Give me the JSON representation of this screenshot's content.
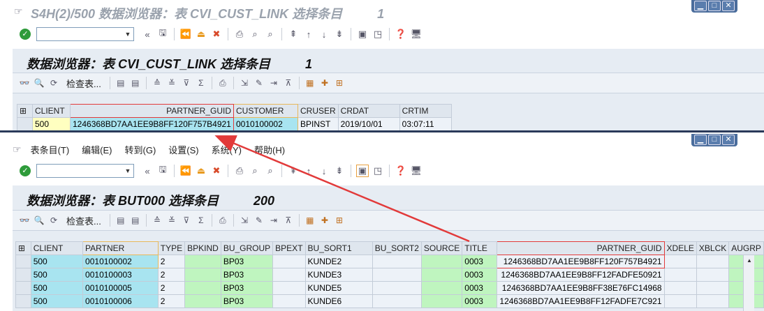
{
  "window1": {
    "title": "S4H(2)/500 数据浏览器：表 CVI_CUST_LINK 选择条目          1"
  },
  "panel1": {
    "title": "数据浏览器：表 CVI_CUST_LINK 选择条目          1",
    "toolbar_text": "检查表..."
  },
  "table1": {
    "headers": [
      "CLIENT",
      "PARTNER_GUID",
      "CUSTOMER",
      "CRUSER",
      "CRDAT",
      "CRTIM"
    ],
    "row": [
      "500",
      "1246368BD7AA1EE9B8FF120F757B4921",
      "0010100002",
      "BPINST",
      "2019/10/01",
      "03:07:11"
    ]
  },
  "menu": {
    "items": [
      "表条目(T)",
      "编辑(E)",
      "转到(G)",
      "设置(S)",
      "系统(Y)",
      "帮助(H)"
    ]
  },
  "panel2": {
    "title": "数据浏览器：表 BUT000 选择条目          200",
    "toolbar_text": "检查表..."
  },
  "table2": {
    "headers": [
      "CLIENT",
      "PARTNER",
      "TYPE",
      "BPKIND",
      "BU_GROUP",
      "BPEXT",
      "BU_SORT1",
      "BU_SORT2",
      "SOURCE",
      "TITLE",
      "PARTNER_GUID",
      "XDELE",
      "XBLCK",
      "AUGRP"
    ],
    "rows": [
      [
        "500",
        "0010100002",
        "2",
        "",
        "BP03",
        "",
        "KUNDE2",
        "",
        "",
        "0003",
        "1246368BD7AA1EE9B8FF120F757B4921",
        "",
        "",
        ""
      ],
      [
        "500",
        "0010100003",
        "2",
        "",
        "BP03",
        "",
        "KUNDE3",
        "",
        "",
        "0003",
        "1246368BD7AA1EE9B8FF12FADFE50921",
        "",
        "",
        ""
      ],
      [
        "500",
        "0010100005",
        "2",
        "",
        "BP03",
        "",
        "KUNDE5",
        "",
        "",
        "0003",
        "1246368BD7AA1EE9B8FF38E76FC14968",
        "",
        "",
        ""
      ],
      [
        "500",
        "0010100006",
        "2",
        "",
        "BP03",
        "",
        "KUNDE6",
        "",
        "",
        "0003",
        "1246368BD7AA1EE9B8FF12FADFE7C921",
        "",
        "",
        ""
      ]
    ]
  },
  "colors": {
    "key_column": "#a8e4f0",
    "highlight": "#ffffc0",
    "green_column": "#bff5bf",
    "annotation_red": "#e23a3a",
    "annotation_orange": "#e8b85a"
  }
}
